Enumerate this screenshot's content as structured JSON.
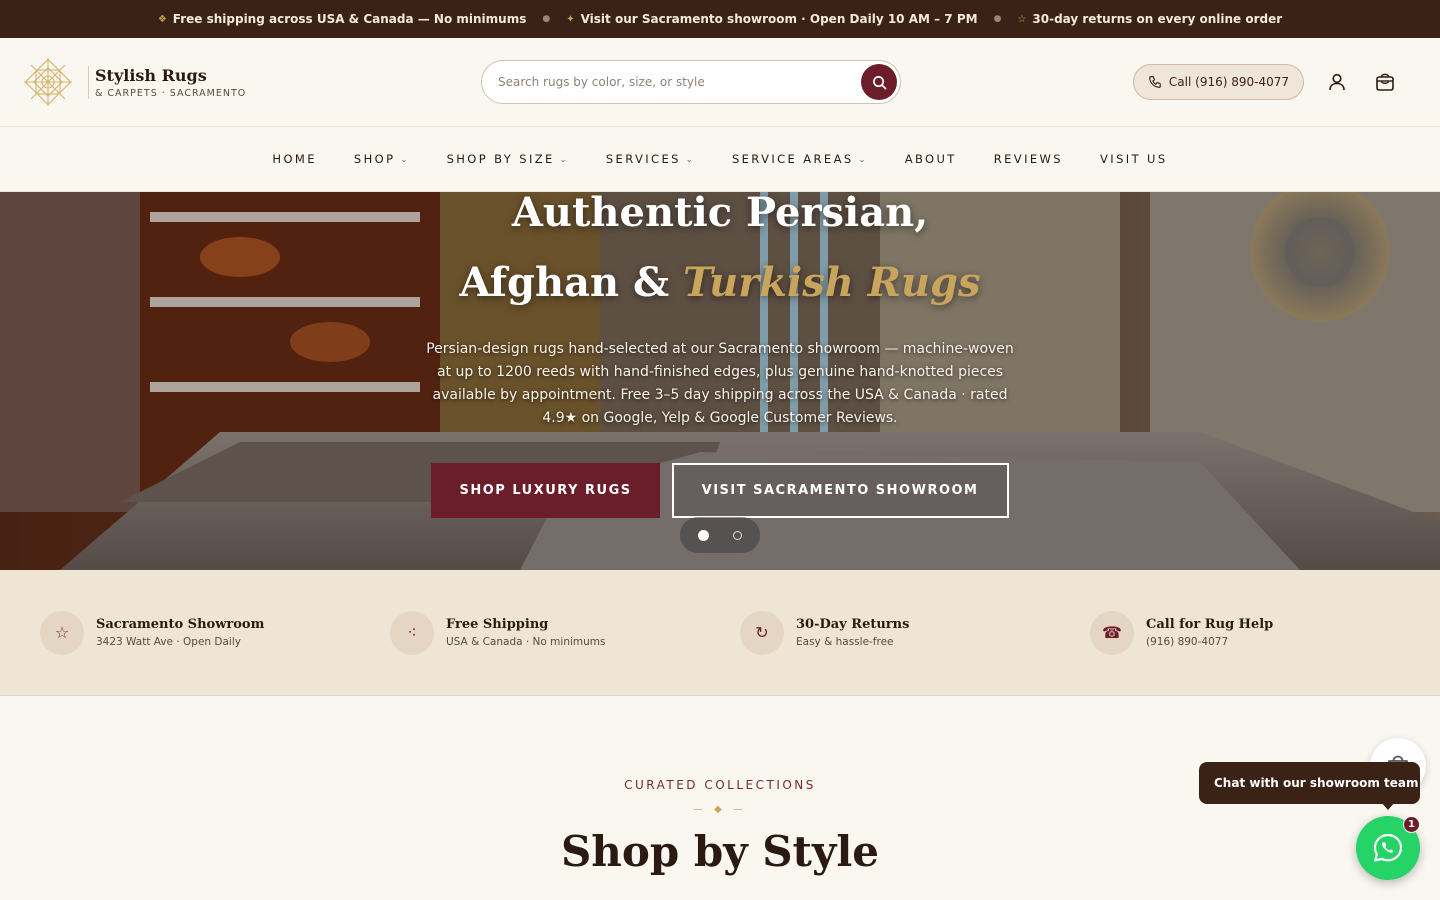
{
  "announcement": {
    "items": [
      {
        "icon": "diamond-icon",
        "text": "Free shipping across USA & Canada — No minimums"
      },
      {
        "icon": "sparkle-icon",
        "text": "Visit our Sacramento showroom · Open Daily 10 AM – 7 PM"
      },
      {
        "icon": "star-icon",
        "text": "30-day returns on every online order"
      }
    ]
  },
  "header": {
    "brand_name": "Stylish Rugs",
    "brand_sub": "& CARPETS · SACRAMENTO",
    "search_placeholder": "Search rugs by color, size, or style",
    "call_label": "Call (916) 890-4077"
  },
  "nav": {
    "items": [
      {
        "label": "HOME",
        "dropdown": false
      },
      {
        "label": "SHOP",
        "dropdown": true
      },
      {
        "label": "SHOP BY SIZE",
        "dropdown": true
      },
      {
        "label": "SERVICES",
        "dropdown": true
      },
      {
        "label": "SERVICE AREAS",
        "dropdown": true
      },
      {
        "label": "ABOUT",
        "dropdown": false
      },
      {
        "label": "REVIEWS",
        "dropdown": false
      },
      {
        "label": "VISIT US",
        "dropdown": false
      }
    ]
  },
  "hero": {
    "title_line1": "Authentic Persian,",
    "title_line2_a": "Afghan & ",
    "title_line2_accent": "Turkish Rugs",
    "description": "Persian-design rugs hand-selected at our Sacramento showroom — machine-woven at up to 1200 reeds with hand-finished edges, plus genuine hand-knotted pieces available by appointment. Free 3–5 day shipping across the USA & Canada · rated 4.9★ on Google, Yelp & Google Customer Reviews.",
    "primary_cta": "SHOP LUXURY RUGS",
    "secondary_cta": "VISIT SACRAMENTO SHOWROOM",
    "slide_count": 2,
    "active_slide": 1
  },
  "features": [
    {
      "icon": "star-icon",
      "glyph": "☆",
      "title": "Sacramento Showroom",
      "sub": "3423 Watt Ave · Open Daily"
    },
    {
      "icon": "truck-icon",
      "glyph": "⁖",
      "title": "Free Shipping",
      "sub": "USA & Canada · No minimums"
    },
    {
      "icon": "return-icon",
      "glyph": "↻",
      "title": "30-Day Returns",
      "sub": "Easy & hassle-free"
    },
    {
      "icon": "phone-icon",
      "glyph": "☎",
      "title": "Call for Rug Help",
      "sub": "(916) 890-4077"
    }
  ],
  "collections": {
    "eyebrow": "CURATED COLLECTIONS",
    "title": "Shop by Style"
  },
  "chat": {
    "bubble_text": "Chat with our showroom team",
    "badge_count": "1"
  },
  "colors": {
    "brand_burgundy": "#6b1e2a",
    "gold_accent": "#c9a45c",
    "dark_brown": "#3b2216",
    "cream": "#faf6f0",
    "whatsapp_green": "#25d366"
  }
}
